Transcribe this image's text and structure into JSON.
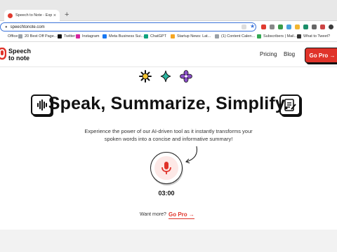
{
  "browser": {
    "tab_title": "Speech to Note - Experience",
    "new_tab_symbol": "+",
    "url": "speechtonote.com",
    "bookmarks": [
      {
        "label": "Office",
        "color": "#ffffff"
      },
      {
        "label": "20 Best Off Page...",
        "color": "#9aa0a6"
      },
      {
        "label": "Twitter",
        "color": "#111111"
      },
      {
        "label": "Instagram",
        "color": "#d6249f"
      },
      {
        "label": "Meta Business Sui...",
        "color": "#1877f2"
      },
      {
        "label": "ChatGPT",
        "color": "#10a37f"
      },
      {
        "label": "Startup News: Lat...",
        "color": "#f5a623"
      },
      {
        "label": "(1) Content Calen...",
        "color": "#9aa0a6"
      },
      {
        "label": "Subscribers | Mail...",
        "color": "#34a853"
      },
      {
        "label": "What to Tweet?",
        "color": "#333333"
      }
    ]
  },
  "header": {
    "logo_line1": "Speech",
    "logo_line2": "to note",
    "nav_pricing": "Pricing",
    "nav_blog": "Blog",
    "go_pro_button": "Go Pro →"
  },
  "hero": {
    "headline": "Speak, Summarize, Simplify.",
    "description": "Experience the power of our AI-driven tool as it instantly transforms your spoken words into a concise and informative summary!",
    "timer": "03:00",
    "want_more": "Want more?",
    "go_pro_link": "Go Pro →"
  },
  "colors": {
    "accent": "#e0332a",
    "mic_bg": "#fde8e6",
    "teal_star": "#2bb5a0",
    "purple_flower": "#8a4fc7"
  }
}
